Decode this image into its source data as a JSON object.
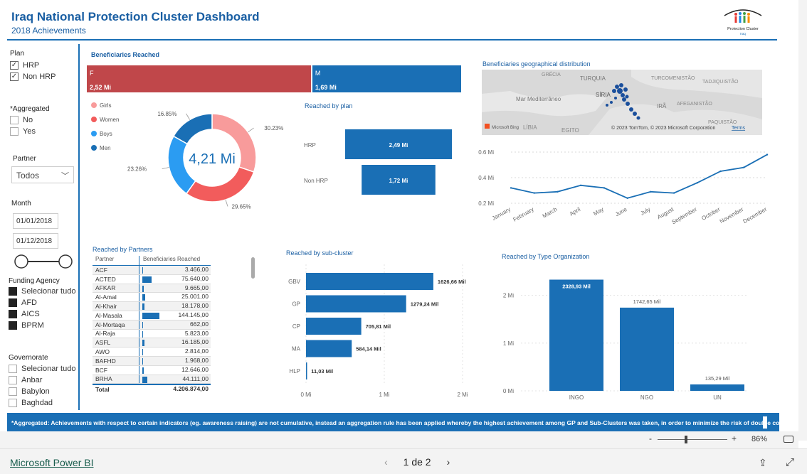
{
  "header": {
    "title": "Iraq National Protection Cluster Dashboard",
    "subtitle": "2018 Achievements",
    "logo_text": "Protection Cluster",
    "logo_subtext": "Iraq"
  },
  "filters": {
    "plan": {
      "label": "Plan",
      "items": [
        {
          "label": "HRP",
          "checked": true
        },
        {
          "label": "Non HRP",
          "checked": true
        }
      ]
    },
    "aggregated": {
      "label": "*Aggregated",
      "items": [
        {
          "label": "No",
          "checked": false
        },
        {
          "label": "Yes",
          "checked": false
        }
      ]
    },
    "partner": {
      "label": "Partner",
      "value": "Todos"
    },
    "month": {
      "label": "Month",
      "start": "01/01/2018",
      "end": "01/12/2018"
    },
    "funding": {
      "label": "Funding Agency",
      "items": [
        "Selecionar tudo",
        "AFD",
        "AICS",
        "BPRM"
      ]
    },
    "governorate": {
      "label": "Governorate",
      "items": [
        "Selecionar tudo",
        "Anbar",
        "Babylon",
        "Baghdad"
      ]
    }
  },
  "beneficiaries": {
    "title": "Beneficiaries Reached",
    "gender": [
      {
        "label": "F",
        "value_text": "2,52 Mi",
        "value": 2.52,
        "color": "#c0474a"
      },
      {
        "label": "M",
        "value_text": "1,69 Mi",
        "value": 1.69,
        "color": "#1a6fb5"
      }
    ],
    "donut": {
      "center": "4,21 Mi",
      "segments": [
        {
          "label": "Girls",
          "pct": 30.23,
          "pct_text": "30.23%",
          "color": "#f89b9b"
        },
        {
          "label": "Women",
          "pct": 29.65,
          "pct_text": "29.65%",
          "color": "#f25c5c"
        },
        {
          "label": "Boys",
          "pct": 23.26,
          "pct_text": "23.26%",
          "color": "#2b9cf2"
        },
        {
          "label": "Men",
          "pct": 16.85,
          "pct_text": "16.85%",
          "color": "#1a6fb5"
        }
      ]
    }
  },
  "by_plan": {
    "title": "Reached by plan",
    "items": [
      {
        "label": "HRP",
        "value": 2.49,
        "value_text": "2,49 Mi"
      },
      {
        "label": "Non HRP",
        "value": 1.72,
        "value_text": "1,72 Mi"
      }
    ]
  },
  "geo": {
    "title": "Beneficiaries geographical distribution",
    "labels": [
      "GRÉCIA",
      "TURQUIA",
      "TURCOMENISTÃO",
      "TADJIQUISTÃO",
      "Mar Mediterrâneo",
      "SÍRIA",
      "IRÃ",
      "AFEGANISTÃO",
      "PAQUISTÃO",
      "LÍBIA",
      "EGITO"
    ],
    "brand": "Microsoft Bing",
    "copyright": "© 2023 TomTom, © 2023 Microsoft Corporation",
    "terms": "Terms"
  },
  "chart_data": [
    {
      "type": "line",
      "title": "",
      "categories": [
        "January",
        "February",
        "March",
        "April",
        "May",
        "June",
        "July",
        "August",
        "September",
        "October",
        "November",
        "December"
      ],
      "values": [
        0.32,
        0.28,
        0.29,
        0.34,
        0.32,
        0.24,
        0.29,
        0.28,
        0.36,
        0.45,
        0.48,
        0.58
      ],
      "ylim": [
        0.2,
        0.6
      ],
      "yticks": [
        "0.2 Mi",
        "0.4 Mi",
        "0.6 Mi"
      ]
    },
    {
      "type": "bar",
      "title": "Reached by sub-cluster",
      "orientation": "horizontal",
      "categories": [
        "GBV",
        "GP",
        "CP",
        "MA",
        "HLP"
      ],
      "values": [
        1626.66,
        1279.24,
        705.81,
        584.14,
        11.03
      ],
      "value_labels": [
        "1626,66 Mil",
        "1279,24 Mil",
        "705,81 Mil",
        "584,14 Mil",
        "11,03 Mil"
      ],
      "xlim": [
        0,
        2000
      ],
      "xticks": [
        "0 Mi",
        "1 Mi",
        "2 Mi"
      ]
    },
    {
      "type": "bar",
      "title": "Reached by Type Organization",
      "categories": [
        "INGO",
        "NGO",
        "UN"
      ],
      "values": [
        2328.93,
        1742.65,
        135.29
      ],
      "value_labels": [
        "2328,93 Mil",
        "1742,65 Mil",
        "135,29 Mil"
      ],
      "ylim": [
        0,
        2500
      ],
      "yticks": [
        "0 Mi",
        "1 Mi",
        "2 Mi"
      ]
    }
  ],
  "partners": {
    "title": "Reached by Partners",
    "col1": "Partner",
    "col2": "Beneficiaries Reached",
    "rows": [
      {
        "name": "ACF",
        "value": 3466,
        "text": "3.466,00"
      },
      {
        "name": "ACTED",
        "value": 75640,
        "text": "75.640,00"
      },
      {
        "name": "AFKAR",
        "value": 9665,
        "text": "9.665,00"
      },
      {
        "name": "Al-Amal",
        "value": 25001,
        "text": "25.001,00"
      },
      {
        "name": "Al-Khair",
        "value": 18178,
        "text": "18.178,00"
      },
      {
        "name": "Al-Masala",
        "value": 144145,
        "text": "144.145,00"
      },
      {
        "name": "Al-Mortaqa",
        "value": 662,
        "text": "662,00"
      },
      {
        "name": "Al-Raja",
        "value": 5823,
        "text": "5.823,00"
      },
      {
        "name": "ASFL",
        "value": 16185,
        "text": "16.185,00"
      },
      {
        "name": "AWO",
        "value": 2814,
        "text": "2.814,00"
      },
      {
        "name": "BAFHD",
        "value": 1968,
        "text": "1.968,00"
      },
      {
        "name": "BCF",
        "value": 12646,
        "text": "12.646,00"
      },
      {
        "name": "BRHA",
        "value": 44111,
        "text": "44.111,00"
      }
    ],
    "total_label": "Total",
    "total": "4.206.874,00"
  },
  "footnote": "*Aggregated: Achievements with respect to certain indicators (eg. awareness raising) are not cumulative, instead an aggregation rule has been applied whereby the highest achievement among GP and Sub-Clusters was taken, in order to minimize the risk of double counting.",
  "zoom": {
    "value": "86%",
    "minus": "-",
    "plus": "+"
  },
  "bottom": {
    "brand": "Microsoft Power BI",
    "page": "1 de 2"
  }
}
